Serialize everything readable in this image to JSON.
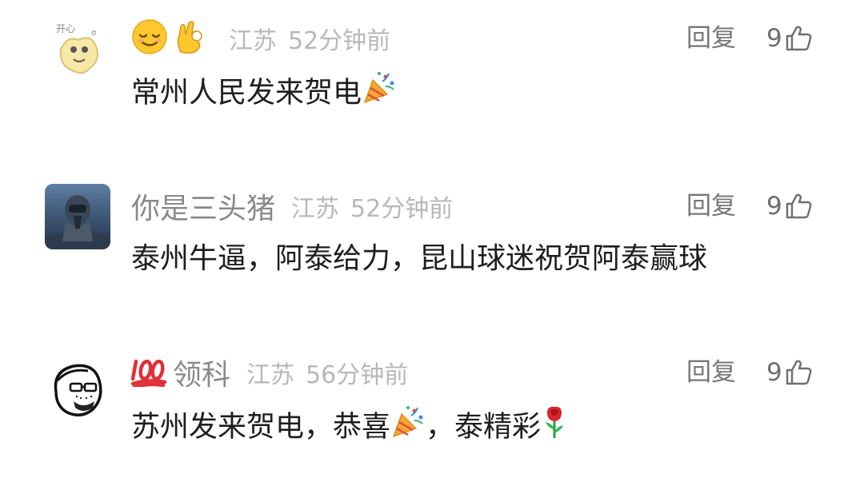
{
  "comments": [
    {
      "username": "",
      "username_emojis": [
        "relieved-face-emoji",
        "ok-hand-emoji"
      ],
      "location": "江苏",
      "time": "52分钟前",
      "reply_label": "回复",
      "likes": "9",
      "text": "常州人民发来贺电",
      "text_emoji": "party-popper-emoji"
    },
    {
      "username": "你是三头猪",
      "location": "江苏",
      "time": "52分钟前",
      "reply_label": "回复",
      "likes": "9",
      "text": "泰州牛逼，阿泰给力，昆山球迷祝贺阿泰赢球"
    },
    {
      "username": "领科",
      "username_emoji": "hundred-points-emoji",
      "location": "江苏",
      "time": "56分钟前",
      "reply_label": "回复",
      "likes": "9",
      "text_part1": "苏州发来贺电，恭喜",
      "text_part2": "，泰精彩",
      "text_emojis": [
        "party-popper-emoji",
        "rose-emoji"
      ]
    }
  ],
  "colors": {
    "username": "#8a8a8a",
    "meta": "#b8b8b8",
    "body_text": "#1e1e1e",
    "action": "#777777"
  }
}
